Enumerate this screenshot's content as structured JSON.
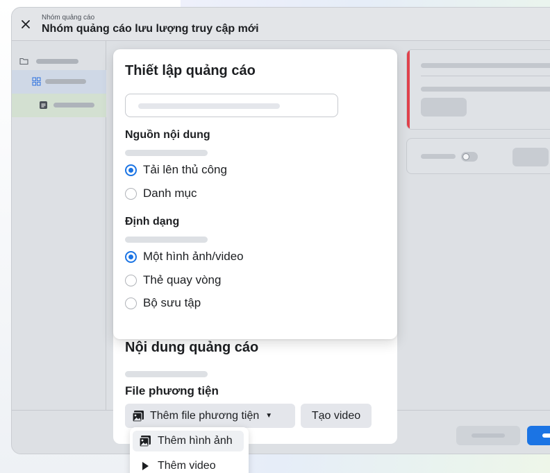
{
  "window": {
    "subtitle": "Nhóm quảng cáo",
    "title": "Nhóm quảng cáo lưu lượng truy cập mới"
  },
  "ad_setup": {
    "title": "Thiết lập quảng cáo",
    "content_source": {
      "label": "Nguồn nội dung",
      "options": [
        {
          "label": "Tải lên thủ công",
          "selected": true
        },
        {
          "label": "Danh mục",
          "selected": false
        }
      ]
    },
    "format": {
      "label": "Định dạng",
      "options": [
        {
          "label": "Một hình ảnh/video",
          "selected": true
        },
        {
          "label": "Thẻ quay vòng",
          "selected": false
        },
        {
          "label": "Bộ sưu tập",
          "selected": false
        }
      ]
    }
  },
  "ad_content": {
    "title": "Nội dung quảng cáo",
    "media_label": "File phương tiện",
    "add_media_button": "Thêm file phương tiện",
    "create_video_button": "Tạo video"
  },
  "media_menu": {
    "items": [
      {
        "label": "Thêm hình ảnh",
        "icon": "image-icon"
      },
      {
        "label": "Thêm video",
        "icon": "play-icon"
      }
    ]
  },
  "colors": {
    "accent": "#1b74e4",
    "error_stripe": "#e0424c"
  }
}
